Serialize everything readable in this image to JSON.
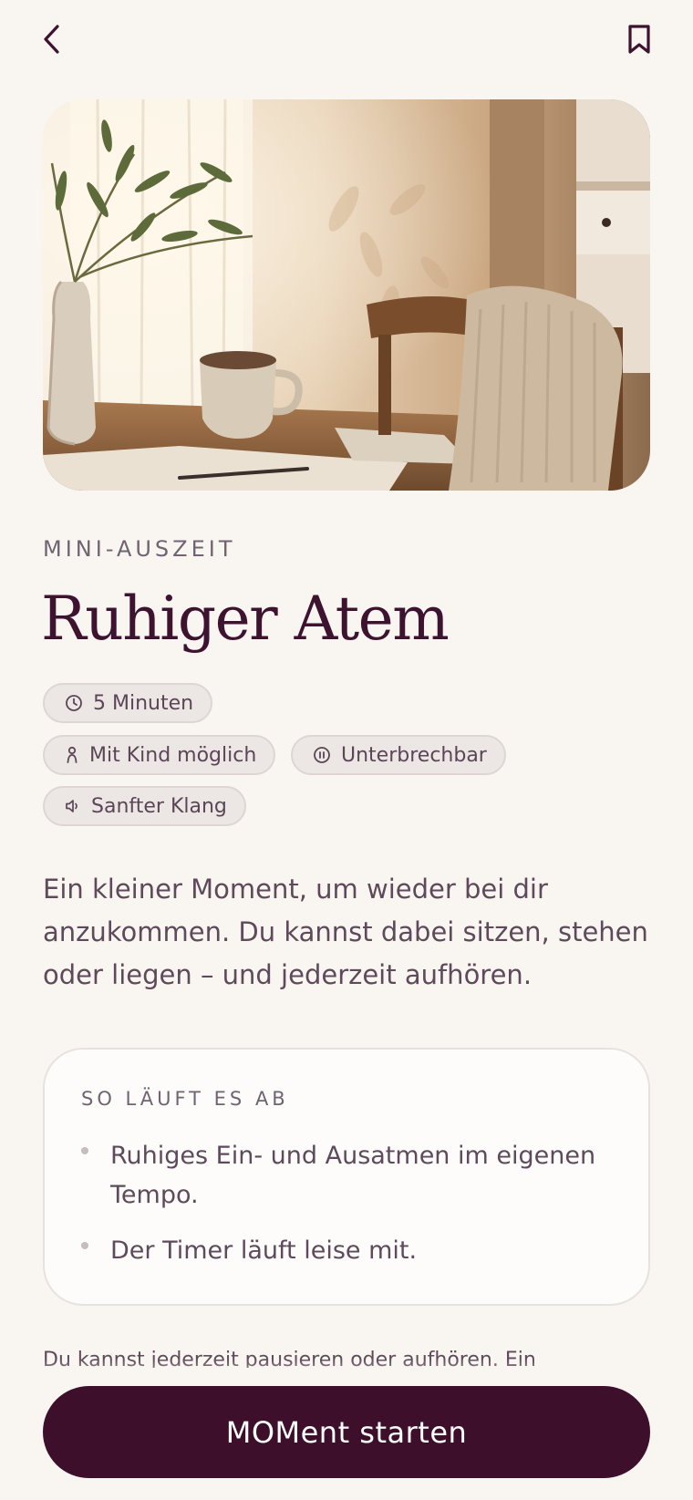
{
  "header": {
    "back_icon": "chevron-left-icon",
    "bookmark_icon": "bookmark-icon"
  },
  "hero": {
    "subject": "Holztisch mit Tasse, Vase mit Olivenzweigen, Stuhl mit Strickdecke im Sonnenlicht"
  },
  "eyebrow": "MINI-AUSZEIT",
  "title": "Ruhiger Atem",
  "chips": [
    {
      "icon": "clock-icon",
      "label": "5 Minuten"
    },
    {
      "icon": "person-icon",
      "label": "Mit Kind möglich"
    },
    {
      "icon": "pause-icon",
      "label": "Unterbrechbar"
    },
    {
      "icon": "speaker-icon",
      "label": "Sanfter Klang"
    }
  ],
  "description": "Ein kleiner Moment, um wieder bei dir anzukommen. Du kannst dabei sitzen, stehen oder liegen – und jederzeit aufhören.",
  "steps_card": {
    "heading": "SO LÄUFT ES AB",
    "items": [
      "Ruhiges Ein- und Ausatmen im eigenen Tempo.",
      "Der Timer läuft leise mit."
    ]
  },
  "footer_note": "Du kannst jederzeit pausieren oder aufhören. Ein",
  "cta": {
    "label": "MOMent starten"
  },
  "colors": {
    "background": "#f9f6f2",
    "title": "#3e1330",
    "cta": "#3e0f2b",
    "chip_bg": "#ece7e4"
  }
}
